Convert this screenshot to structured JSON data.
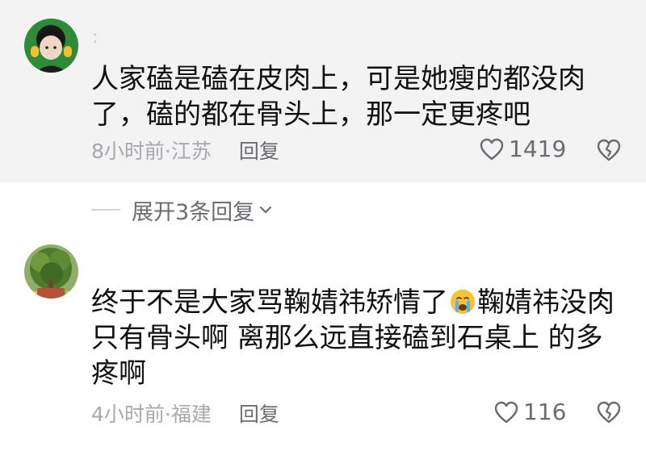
{
  "comments": [
    {
      "username": "  :",
      "text": "人家磕是磕在皮肉上，可是她瘦的都没肉了，磕的都在骨头上，那一定更疼吧",
      "time_location": "8小时前·江苏",
      "reply_label": "回复",
      "like_count": "1419"
    },
    {
      "text_before_emoji": "终于不是大家骂鞠婧祎矫情了",
      "emoji": "crying-face",
      "text_after_emoji": "鞠婧祎没肉只有骨头啊 离那么远直接磕到石桌上 的多疼啊",
      "time_location": "4小时前·福建",
      "reply_label": "回复",
      "like_count": "116"
    }
  ],
  "expand_replies": {
    "label": "展开3条回复"
  },
  "icons": {
    "like": "heart-outline-icon",
    "dislike": "broken-heart-outline-icon",
    "expand": "chevron-down-icon"
  },
  "colors": {
    "highlighted_comment_bg": "#f3f3f3",
    "meta_text": "#a8a8ae",
    "action_text": "#6b6c72"
  }
}
